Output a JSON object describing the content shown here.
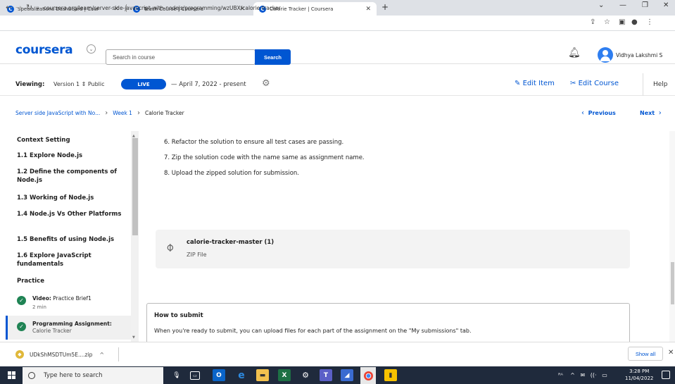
{
  "browser": {
    "tabs": [
      {
        "title": "Specializations Dashboard | Cour",
        "active": false
      },
      {
        "title": "Teach Course | Coursera",
        "active": false
      },
      {
        "title": "Calorie Tracker | Coursera",
        "active": true
      }
    ],
    "url": "coursera.org/learn/server-side-javascript-with-nodejs/programming/wzUBX/calorie-tracker"
  },
  "header": {
    "logo": "coursera",
    "search_placeholder": "Search in course",
    "search_button": "Search",
    "username": "Vidhya Lakshmi S"
  },
  "viewbar": {
    "viewing_label": "Viewing:",
    "version": "Version 1 ⇕ Public",
    "live_badge": "LIVE",
    "date_range": "— April 7, 2022 - present",
    "edit_item": "Edit Item",
    "edit_course": "Edit Course",
    "help": "Help"
  },
  "breadcrumb": {
    "course": "Server side JavaScript with No...",
    "week": "Week 1",
    "current": "Calorie Tracker",
    "previous": "Previous",
    "next": "Next"
  },
  "sidebar": {
    "items": [
      {
        "label": "Context Setting"
      },
      {
        "label": "1.1 Explore Node.js"
      },
      {
        "label": "1.2 Define the components of Node.js"
      },
      {
        "label": "1.3 Working of Node.js"
      },
      {
        "label": "1.4 Node.js Vs Other Platforms"
      },
      {
        "label": "1.5 Benefits of using Node.js"
      },
      {
        "label": "1.6 Explore JavaScript fundamentals"
      },
      {
        "label": "Practice"
      }
    ],
    "sub_items": [
      {
        "type": "Video:",
        "title": "Practice Brief1",
        "meta": "2 min"
      },
      {
        "type": "Programming Assignment:",
        "title": "Calorie Tracker",
        "meta": ""
      }
    ]
  },
  "main": {
    "steps": [
      "6.  Refactor the solution to ensure all test cases are passing.",
      "7.  Zip the solution code with the name same as assignment name.",
      "8.  Upload the zipped solution for submission."
    ],
    "attachment": {
      "name": "calorie-tracker-master (1)",
      "type": "ZIP File"
    },
    "submit": {
      "title": "How to submit",
      "text": "When you're ready to submit, you can upload files for each part of the assignment on the \"My submissions\" tab."
    }
  },
  "downloads": {
    "file": "UDkShMSDTUm5E....zip",
    "show_all": "Show all"
  },
  "taskbar": {
    "search_placeholder": "Type here to search",
    "time": "3:28 PM",
    "date": "11/04/2022"
  }
}
